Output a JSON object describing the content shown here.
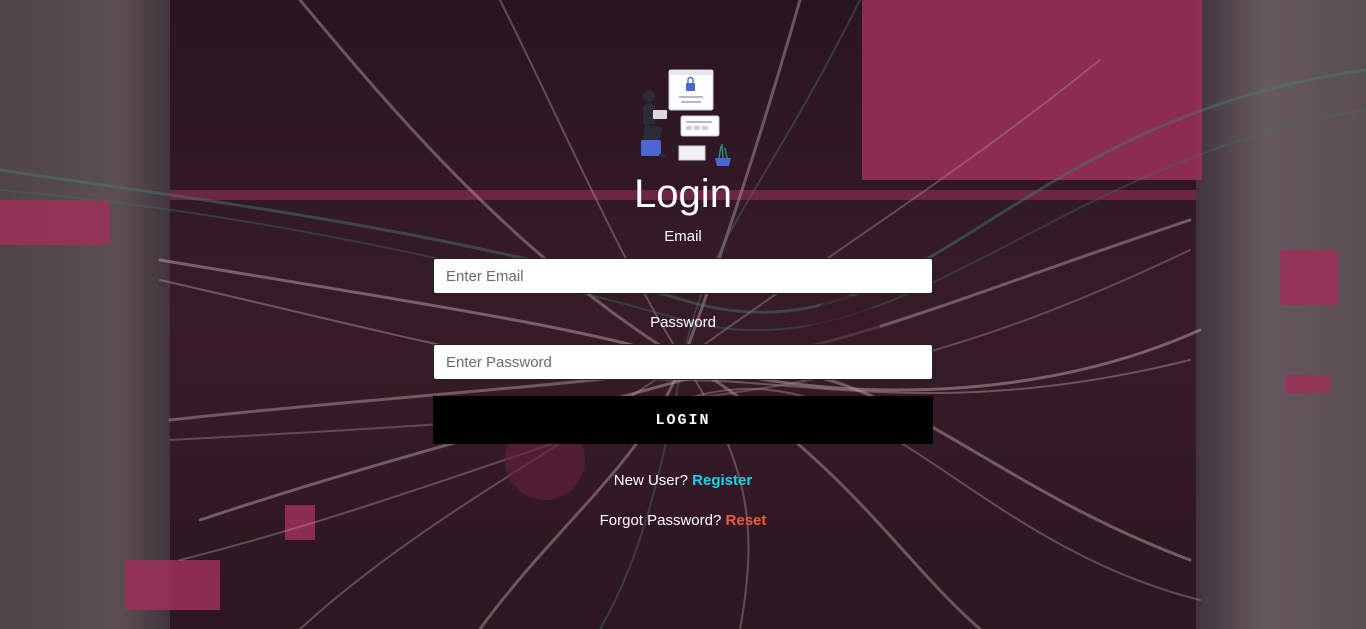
{
  "login": {
    "title": "Login",
    "email_label": "Email",
    "email_placeholder": "Enter Email",
    "email_value": "",
    "password_label": "Password",
    "password_placeholder": "Enter Password",
    "password_value": "",
    "submit_label": "LOGIN"
  },
  "links": {
    "new_user_prompt": "New User?",
    "register_label": "Register",
    "forgot_prompt": "Forgot Password?",
    "reset_label": "Reset"
  },
  "icons": {
    "illustration": "login-illustration-icon"
  },
  "colors": {
    "button_bg": "#000000",
    "register_link": "#19d3e6",
    "reset_link": "#f05a3a",
    "background_accent": "#c23a6c"
  }
}
